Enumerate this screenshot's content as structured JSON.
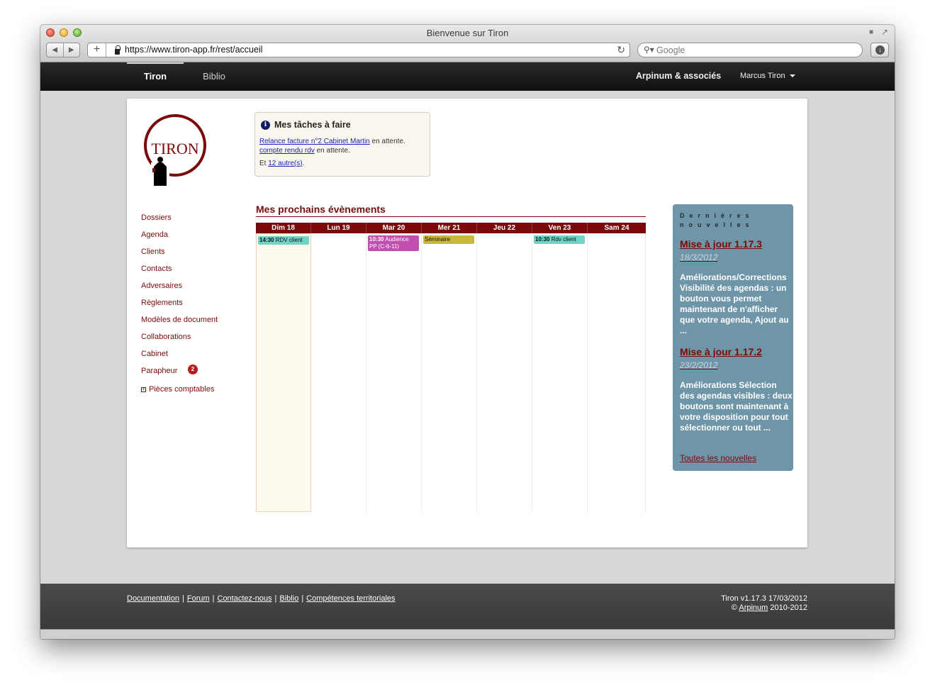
{
  "window": {
    "title": "Bienvenue sur Tiron"
  },
  "browser": {
    "back_icon": "triangle-left",
    "forward_icon": "triangle-right",
    "new_tab_label": "+",
    "url": "https://www.tiron-app.fr/rest/accueil",
    "search_placeholder": "Google"
  },
  "appbar": {
    "tabs": [
      {
        "label": "Tiron",
        "active": true
      },
      {
        "label": "Biblio",
        "active": false
      }
    ],
    "firm": "Arpinum & associés",
    "user": "Marcus Tiron"
  },
  "logo": {
    "text": "TIRON"
  },
  "tasks": {
    "title": "Mes tâches à faire",
    "items": [
      {
        "link": "Relance facture n°2 Cabinet Martin",
        "status": "en attente."
      },
      {
        "link": "compte rendu rdv",
        "status": "en attente."
      }
    ],
    "more_prefix": "Et",
    "more_link": "12 autre(s)",
    "more_suffix": "."
  },
  "sidebar": {
    "items": [
      {
        "label": "Dossiers"
      },
      {
        "label": "Agenda"
      },
      {
        "label": "Clients"
      },
      {
        "label": "Contacts"
      },
      {
        "label": "Adversaires"
      },
      {
        "label": "Règlements"
      },
      {
        "label": "Modèles de document"
      },
      {
        "label": "Collaborations"
      },
      {
        "label": "Cabinet"
      },
      {
        "label": "Parapheur",
        "badge": "2"
      },
      {
        "label": "Pièces comptables",
        "expandable": true
      }
    ]
  },
  "events": {
    "title": "Mes prochains évènements",
    "days": [
      "Dim 18",
      "Lun 19",
      "Mar 20",
      "Mer 21",
      "Jeu 22",
      "Ven 23",
      "Sam 24"
    ],
    "entries": [
      {
        "day": 0,
        "time": "14:30",
        "label": "RDV client",
        "color": "#6fd3c6"
      },
      {
        "day": 2,
        "time": "10:30",
        "label": "Audience PP (C-6-11)",
        "color": "#c24fb0"
      },
      {
        "day": 3,
        "time": "",
        "label": "Séminaire",
        "color": "#c9b83c"
      },
      {
        "day": 5,
        "time": "10:30",
        "label": "Rdv client",
        "color": "#6fd3c6"
      }
    ]
  },
  "news": {
    "title": "Dernières nouvelles",
    "items": [
      {
        "headline": "Mise à jour 1.17.3",
        "date": "18/3/2012",
        "body": "Améliorations/Corrections Visibilité des agendas : un bouton vous permet maintenant de n'afficher que votre agenda, Ajout au ..."
      },
      {
        "headline": "Mise à jour 1.17.2",
        "date": "23/2/2012",
        "body": "Améliorations Sélection des agendas visibles : deux boutons sont maintenant à votre disposition pour tout sélectionner ou tout ..."
      }
    ],
    "all_link": "Toutes les nouvelles"
  },
  "footer": {
    "links": [
      "Documentation",
      "Forum",
      "Contactez-nous",
      "Biblio",
      "Compétences territoriales"
    ],
    "separator": "|",
    "version": "Tiron v1.17.3 17/03/2012",
    "copyright_prefix": "©",
    "copyright_link": "Arpinum",
    "copyright_years": "2010-2012"
  }
}
